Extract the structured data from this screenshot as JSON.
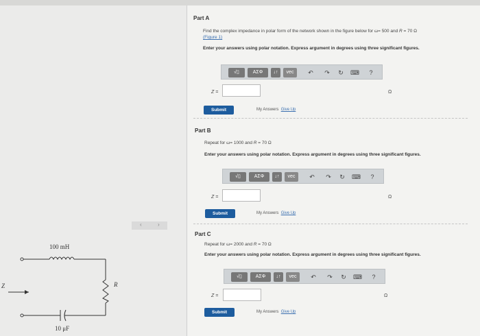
{
  "parts": [
    {
      "title": "Part A",
      "prompt_prefix": "Find the complex impedance in polar form of the network shown in the figure below for ω= 500 and ",
      "prompt_var": "R",
      "prompt_suffix": " = 70 Ω",
      "figure_link": "(Figure 1)",
      "instruction": "Enter your answers using polar notation. Express argument in degrees using three significant figures.",
      "eq_label": "Z =",
      "unit": "Ω",
      "submit": "Submit",
      "my_answers": "My Answers",
      "give_up": "Give Up"
    },
    {
      "title": "Part B",
      "prompt_prefix": "Repeat for ω= 1000 and ",
      "prompt_var": "R",
      "prompt_suffix": " = 70 Ω",
      "instruction": "Enter your answers using polar notation. Express argument in degrees using three significant figures.",
      "eq_label": "Z =",
      "unit": "Ω",
      "submit": "Submit",
      "my_answers": "My Answers",
      "give_up": "Give Up"
    },
    {
      "title": "Part C",
      "prompt_prefix": "Repeat for ω= 2000 and ",
      "prompt_var": "R",
      "prompt_suffix": " = 70 Ω",
      "instruction": "Enter your answers using polar notation. Express argument in degrees using three significant figures.",
      "eq_label": "Z =",
      "unit": "Ω",
      "submit": "Submit",
      "my_answers": "My Answers",
      "give_up": "Give Up"
    }
  ],
  "toolbar": {
    "sqrt_label": "√▯",
    "greek_label": "ΑΣΦ",
    "arrows_label": "↓↑",
    "vec_label": "vec",
    "help_label": "?"
  },
  "figure": {
    "inductor_label": "100 mH",
    "capacitor_label": "10 μF",
    "resistor_label": "R",
    "z_label": "Z"
  },
  "nav": {
    "prev": "‹",
    "next": "›"
  }
}
